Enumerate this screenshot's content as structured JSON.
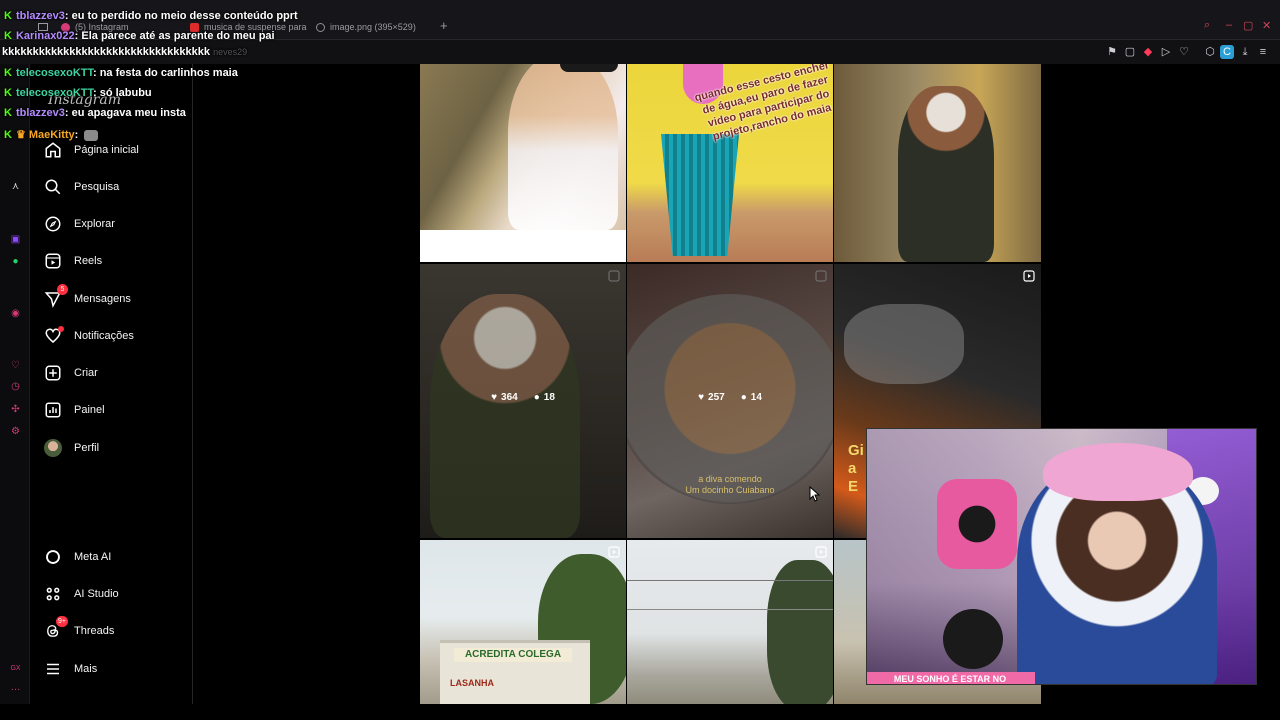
{
  "browser": {
    "tabs": [
      {
        "label": "(5) Instagram",
        "color": "#d63a78"
      },
      {
        "label": "musica de suspense para",
        "color": "#e02b2b"
      },
      {
        "label": "image.png (395×529)",
        "color": "#8d8d93"
      }
    ]
  },
  "sidebar": {
    "logo": "Instagram",
    "items": [
      {
        "label": "Página inicial",
        "icon": "home-icon"
      },
      {
        "label": "Pesquisa",
        "icon": "search-icon"
      },
      {
        "label": "Explorar",
        "icon": "compass-icon"
      },
      {
        "label": "Reels",
        "icon": "reels-icon"
      },
      {
        "label": "Mensagens",
        "icon": "messenger-icon",
        "badge": "5"
      },
      {
        "label": "Notificações",
        "icon": "heart-icon"
      },
      {
        "label": "Criar",
        "icon": "plus-square-icon"
      },
      {
        "label": "Painel",
        "icon": "dashboard-icon"
      },
      {
        "label": "Perfil",
        "icon": "avatar-icon"
      }
    ],
    "bottom_items": [
      {
        "label": "Meta AI",
        "icon": "meta-ai-icon"
      },
      {
        "label": "AI Studio",
        "icon": "ai-studio-icon"
      },
      {
        "label": "Threads",
        "icon": "threads-icon",
        "badge": "9+"
      },
      {
        "label": "Mais",
        "icon": "menu-icon"
      }
    ]
  },
  "grid": {
    "post2_text": "quando esse cesto encher de água,eu paro de fazer video para participar do projeto,rancho do maia",
    "post4": {
      "likes": "364",
      "comments": "18"
    },
    "post5": {
      "likes": "257",
      "comments": "14",
      "caption_line1": "a diva comendo",
      "caption_line2": "Um docinho Cuiabano"
    },
    "post7_sign": "ACREDITA COLEGA",
    "post7_sign2": "LASANHA"
  },
  "chat": {
    "messages": [
      {
        "user": "tblazzev3",
        "color": "#b48cff",
        "text": ": eu to perdido no meio desse conteúdo pprt"
      },
      {
        "user": "Karinax022",
        "color": "#b48cff",
        "text": ": Ela parece até as parente do meu pai"
      },
      {
        "user": "",
        "color": "#ffffff",
        "text": "kkkkkkkkkkkkkkkkkkkkkkkkkkkkkkkkkk"
      },
      {
        "user": "telecosexoKTT",
        "color": "#3fd4a0",
        "text": ": na festa do carlinhos maia"
      },
      {
        "user": "telecosexoKTT",
        "color": "#3fd4a0",
        "text": ": só labubu"
      },
      {
        "user": "tblazzev3",
        "color": "#b48cff",
        "text": ": eu apagava meu insta"
      },
      {
        "user": "MaeKitty",
        "color": "#f5a623",
        "text": ":"
      }
    ],
    "faded_name": "neves29"
  },
  "webcam": {
    "banner_text": "MEU SONHO É ESTAR NO"
  },
  "partial_text": {
    "line1": "Gi",
    "line2": "a",
    "line3": "E"
  },
  "colors": {
    "accent": "#ff3040",
    "kick": "#53fc18",
    "chrome": "#16161a"
  }
}
